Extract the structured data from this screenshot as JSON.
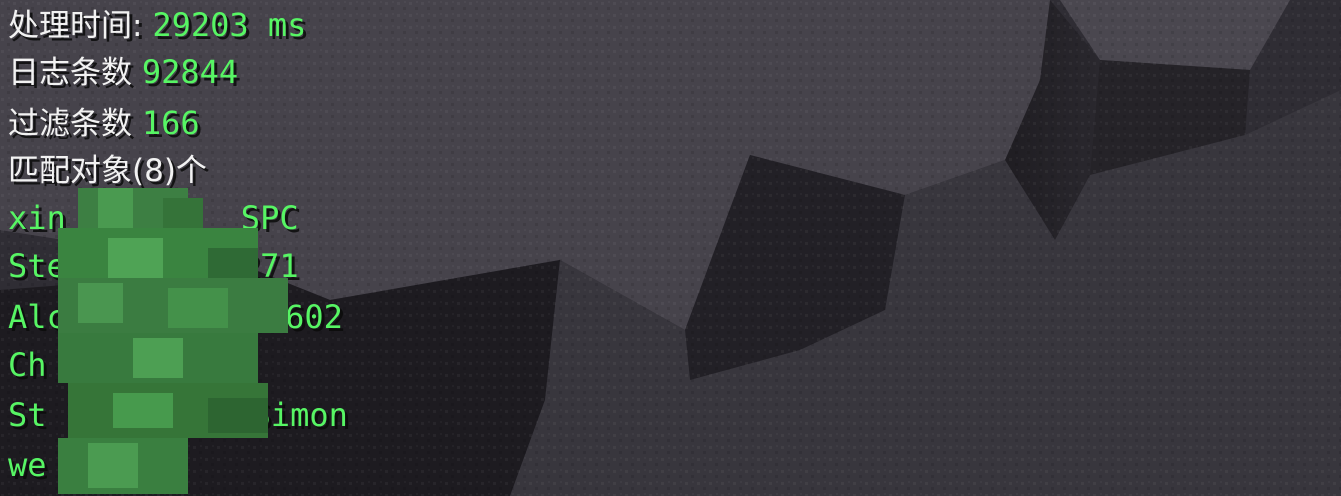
{
  "stats": {
    "time_label": "处理时间: ",
    "time_value": "29203 ms",
    "log_label": "日志条数 ",
    "log_value": "92844",
    "filter_label": "过滤条数 ",
    "filter_value": "166",
    "match_label": "匹配对象(8)个"
  },
  "players": [
    {
      "name_visible": "xin",
      "name_tail": "SPC"
    },
    {
      "name_visible": "Ste",
      "name_tail": "271"
    },
    {
      "name_visible": "Alc",
      "name_tail": "n602"
    },
    {
      "name_visible": "Ch",
      "name_tail": ""
    },
    {
      "name_visible": "St",
      "name_tail": "Simon"
    },
    {
      "name_visible": "we",
      "name_tail": ""
    }
  ],
  "colors": {
    "label": "#f2f2f2",
    "value": "#57f564",
    "stone": "#3a3840",
    "censor": "#3f8e45"
  },
  "icons": {
    "censor": "pixelated-mosaic"
  }
}
